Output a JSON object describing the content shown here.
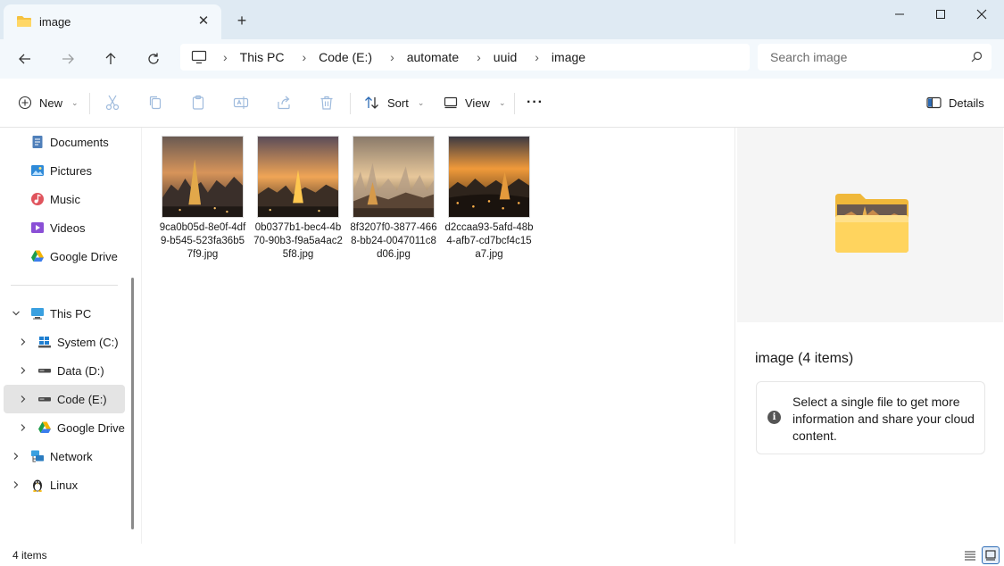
{
  "window": {
    "tab_title": "image",
    "new_tab_label": "+",
    "tab_close_label": "✕"
  },
  "address": {
    "crumbs": [
      "This PC",
      "Code (E:)",
      "automate",
      "uuid",
      "image"
    ],
    "separator": "›",
    "search_placeholder": "Search image"
  },
  "toolbar": {
    "new_label": "New",
    "sort_label": "Sort",
    "view_label": "View",
    "more_label": "···",
    "details_label": "Details"
  },
  "sidebar": {
    "quick_access": [
      {
        "label": "Documents",
        "icon": "documents-icon",
        "pinned": true
      },
      {
        "label": "Pictures",
        "icon": "pictures-icon",
        "pinned": true
      },
      {
        "label": "Music",
        "icon": "music-icon",
        "pinned": true
      },
      {
        "label": "Videos",
        "icon": "videos-icon",
        "pinned": true
      },
      {
        "label": "Google Drive",
        "icon": "google-drive-icon",
        "pinned": true
      }
    ],
    "this_pc_label": "This PC",
    "drives": [
      {
        "label": "System (C:)",
        "icon": "windows-drive-icon"
      },
      {
        "label": "Data (D:)",
        "icon": "drive-icon"
      },
      {
        "label": "Code (E:)",
        "icon": "drive-icon",
        "selected": true
      },
      {
        "label": "Google Drive (",
        "icon": "google-drive-icon"
      }
    ],
    "network_label": "Network",
    "linux_label": "Linux"
  },
  "files": [
    {
      "name": "9ca0b05d-8e0f-4df9-b545-523fa36b57f9.jpg"
    },
    {
      "name": "0b0377b1-bec4-4b70-90b3-f9a5a4ac25f8.jpg"
    },
    {
      "name": "8f3207f0-3877-4668-bb24-0047011c8d06.jpg"
    },
    {
      "name": "d2ccaa93-5afd-48b4-afb7-cd7bcf4c15a7.jpg"
    }
  ],
  "details": {
    "title": "image (4 items)",
    "info_text": "Select a single file to get more information and share your cloud content.",
    "info_icon_label": "i"
  },
  "status": {
    "item_count": "4 items"
  },
  "colors": {
    "titlebar": "#dfeaf3",
    "addressbar": "#f3f8fc",
    "folder_yellow": "#f5c240",
    "selection": "#e4e4e4",
    "accent": "#2c6bb5"
  }
}
